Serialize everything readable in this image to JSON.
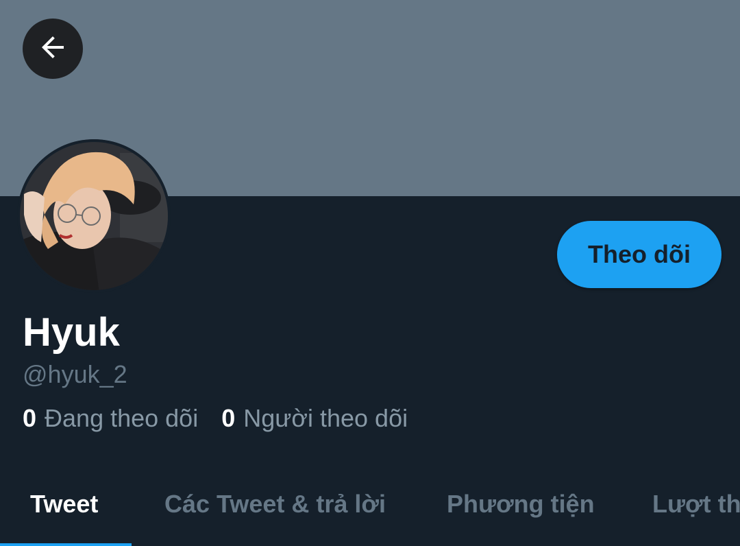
{
  "header": {
    "back_icon": "arrow-left-icon",
    "banner_color": "#657786"
  },
  "profile": {
    "name": "Hyuk",
    "handle": "@hyuk_2",
    "follow_label": "Theo dõi",
    "following_count": "0",
    "following_label": "Đang theo dõi",
    "followers_count": "0",
    "followers_label": "Người theo dõi"
  },
  "tabs": [
    {
      "label": "Tweet",
      "active": true
    },
    {
      "label": "Các Tweet & trả lời",
      "active": false
    },
    {
      "label": "Phương tiện",
      "active": false
    },
    {
      "label": "Lượt thích",
      "active": false
    }
  ],
  "colors": {
    "background": "#15202b",
    "accent": "#1da1f2",
    "muted": "#657786"
  }
}
